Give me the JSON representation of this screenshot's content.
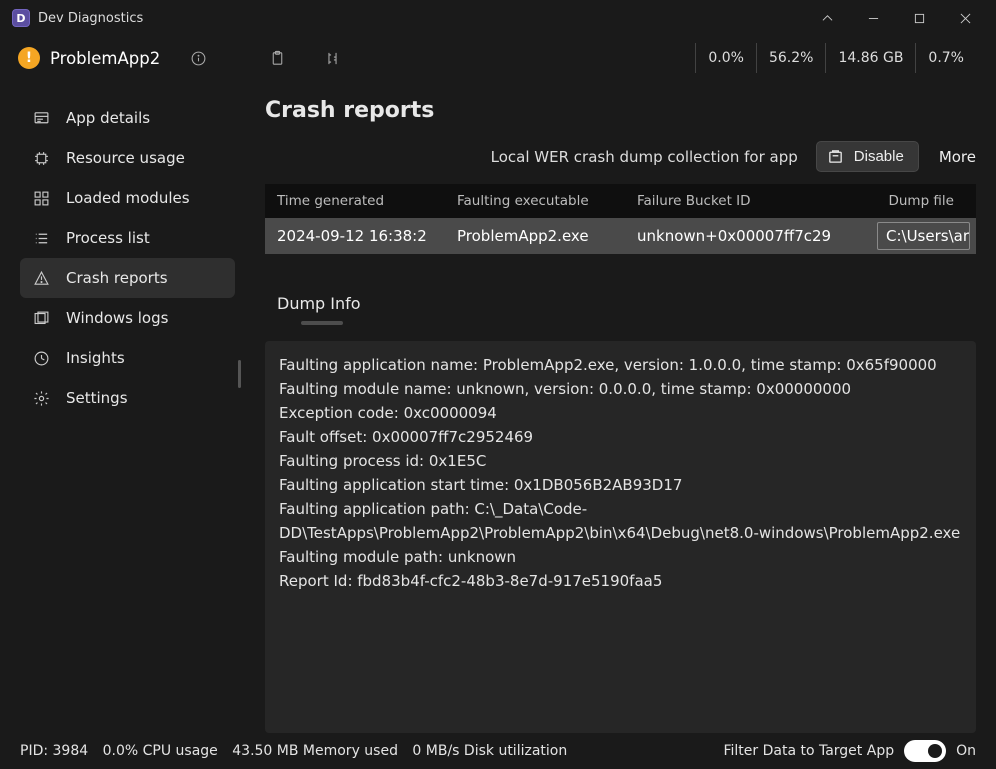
{
  "title": "Dev Diagnostics",
  "process": {
    "name": "ProblemApp2"
  },
  "metrics": {
    "cpu_pct": "0.0%",
    "metric2": "56.2%",
    "memory": "14.86 GB",
    "metric4": "0.7%"
  },
  "sidebar": {
    "items": [
      {
        "label": "App details"
      },
      {
        "label": "Resource usage"
      },
      {
        "label": "Loaded modules"
      },
      {
        "label": "Process list"
      },
      {
        "label": "Crash reports"
      },
      {
        "label": "Windows logs"
      },
      {
        "label": "Insights"
      },
      {
        "label": "Settings"
      }
    ]
  },
  "page": {
    "title": "Crash reports",
    "subhead": "Local WER crash dump collection for app",
    "disable_label": "Disable",
    "more_label": "More"
  },
  "table": {
    "cols": {
      "time": "Time generated",
      "exe": "Faulting executable",
      "bucket": "Failure Bucket ID",
      "dump": "Dump file"
    },
    "rows": [
      {
        "time": "2024-09-12 16:38:2",
        "exe": "ProblemApp2.exe",
        "bucket": "unknown+0x00007ff7c29",
        "dump": "C:\\Users\\ar"
      }
    ]
  },
  "dump": {
    "section_title": "Dump Info",
    "lines": [
      "Faulting application name: ProblemApp2.exe, version: 1.0.0.0, time stamp: 0x65f90000",
      "Faulting module name: unknown, version: 0.0.0.0, time stamp: 0x00000000",
      "Exception code: 0xc0000094",
      "Fault offset: 0x00007ff7c2952469",
      "Faulting process id: 0x1E5C",
      "Faulting application start time: 0x1DB056B2AB93D17",
      "Faulting application path: C:\\_Data\\Code-DD\\TestApps\\ProblemApp2\\ProblemApp2\\bin\\x64\\Debug\\net8.0-windows\\ProblemApp2.exe",
      "Faulting module path: unknown",
      "Report Id: fbd83b4f-cfc2-48b3-8e7d-917e5190faa5"
    ]
  },
  "status": {
    "pid": "PID: 3984",
    "cpu": "0.0% CPU usage",
    "mem": "43.50 MB Memory used",
    "disk": "0 MB/s Disk utilization",
    "filter_label": "Filter Data to Target App",
    "toggle_state": "On"
  }
}
